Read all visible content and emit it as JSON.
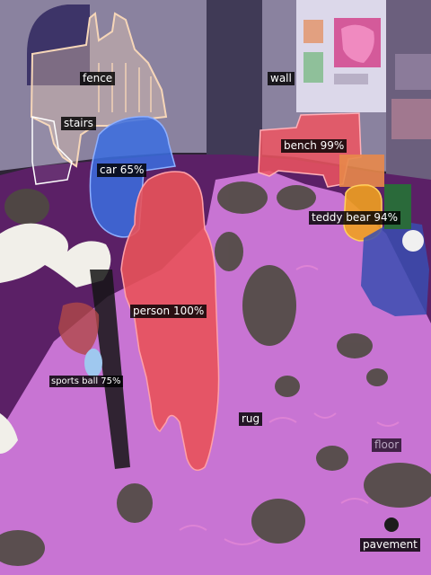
{
  "segments": {
    "fence": {
      "label": "fence",
      "color": "#f6d6b8"
    },
    "wall": {
      "label": "wall",
      "color": "#8f8aa5"
    },
    "stairs": {
      "label": "stairs",
      "color": "#ffffff"
    },
    "car": {
      "label": "car 65%",
      "color": "#3b6fe0"
    },
    "bench": {
      "label": "bench 99%",
      "color": "#ee5560"
    },
    "teddy_bear": {
      "label": "teddy bear 94%",
      "color": "#f0a020"
    },
    "person": {
      "label": "person 100%",
      "color": "#e8525a"
    },
    "sports_ball": {
      "label": "sports ball 75%",
      "color": "#9fc8ef"
    },
    "rug": {
      "label": "rug",
      "color": "#c77ad6"
    },
    "floor": {
      "label": "floor",
      "color": "#5a1f66"
    },
    "pavement": {
      "label": "pavement",
      "color": "#d8d0d8"
    }
  }
}
